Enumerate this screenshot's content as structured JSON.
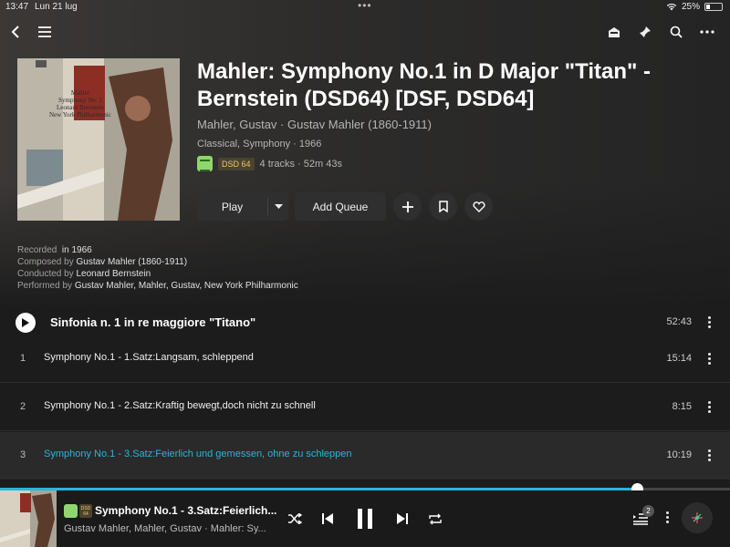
{
  "status_bar": {
    "time": "13:47",
    "date": "Lun 21 lug",
    "battery": "25%"
  },
  "album": {
    "title": "Mahler: Symphony No.1 in D Major \"Titan\" - Bernstein (DSD64) [DSF, DSD64]",
    "artist": "Mahler, Gustav · Gustav Mahler (1860-1911)",
    "genre": "Classical, Symphony · 1966",
    "format_badge": "DSD 64",
    "tracks_info": "4 tracks · 52m 43s",
    "cover_lines": [
      "Mahler",
      "Symphony No. 1",
      "Leonard Bernstein",
      "New York Philharmonic"
    ]
  },
  "actions": {
    "play": "Play",
    "add_queue": "Add Queue"
  },
  "credits": [
    {
      "label": "Recorded",
      "value": "in 1966"
    },
    {
      "label": "Composed by",
      "value": "Gustav Mahler (1860-1911)"
    },
    {
      "label": "Conducted by",
      "value": "Leonard Bernstein"
    },
    {
      "label": "Performed by",
      "value": "Gustav Mahler, Mahler, Gustav, New York Philharmonic"
    }
  ],
  "work": {
    "title": "Sinfonia n. 1 in re maggiore \"Titano\"",
    "duration": "52:43"
  },
  "tracks": [
    {
      "num": "1",
      "title": "Symphony No.1 - 1.Satz:Langsam, schleppend",
      "duration": "15:14"
    },
    {
      "num": "2",
      "title": "Symphony No.1 - 2.Satz:Kraftig bewegt,doch nicht zu schnell",
      "duration": "8:15"
    },
    {
      "num": "3",
      "title": "Symphony No.1 - 3.Satz:Feierlich und gemessen, ohne zu schleppen",
      "duration": "10:19"
    }
  ],
  "now_playing": {
    "title": "Symphony No.1 - 3.Satz:Feierlich...",
    "subtitle": "Gustav Mahler, Mahler, Gustav · Mahler: Sy...",
    "queue_count": "2",
    "progress": 0.873,
    "badge": "DSD 64"
  },
  "colors": {
    "accent": "#29b6d9",
    "playing_track": "#29b6d9",
    "hires_badge": "#8fd66f",
    "dsd_badge_text": "#f0c869"
  },
  "icons": {
    "toolbar": [
      "back-icon",
      "menu-icon",
      "cast-icon",
      "pin-icon",
      "search-icon",
      "more-icon"
    ],
    "player": [
      "shuffle-icon",
      "previous-icon",
      "pause-icon",
      "next-icon",
      "repeat-icon",
      "queue-icon"
    ]
  }
}
